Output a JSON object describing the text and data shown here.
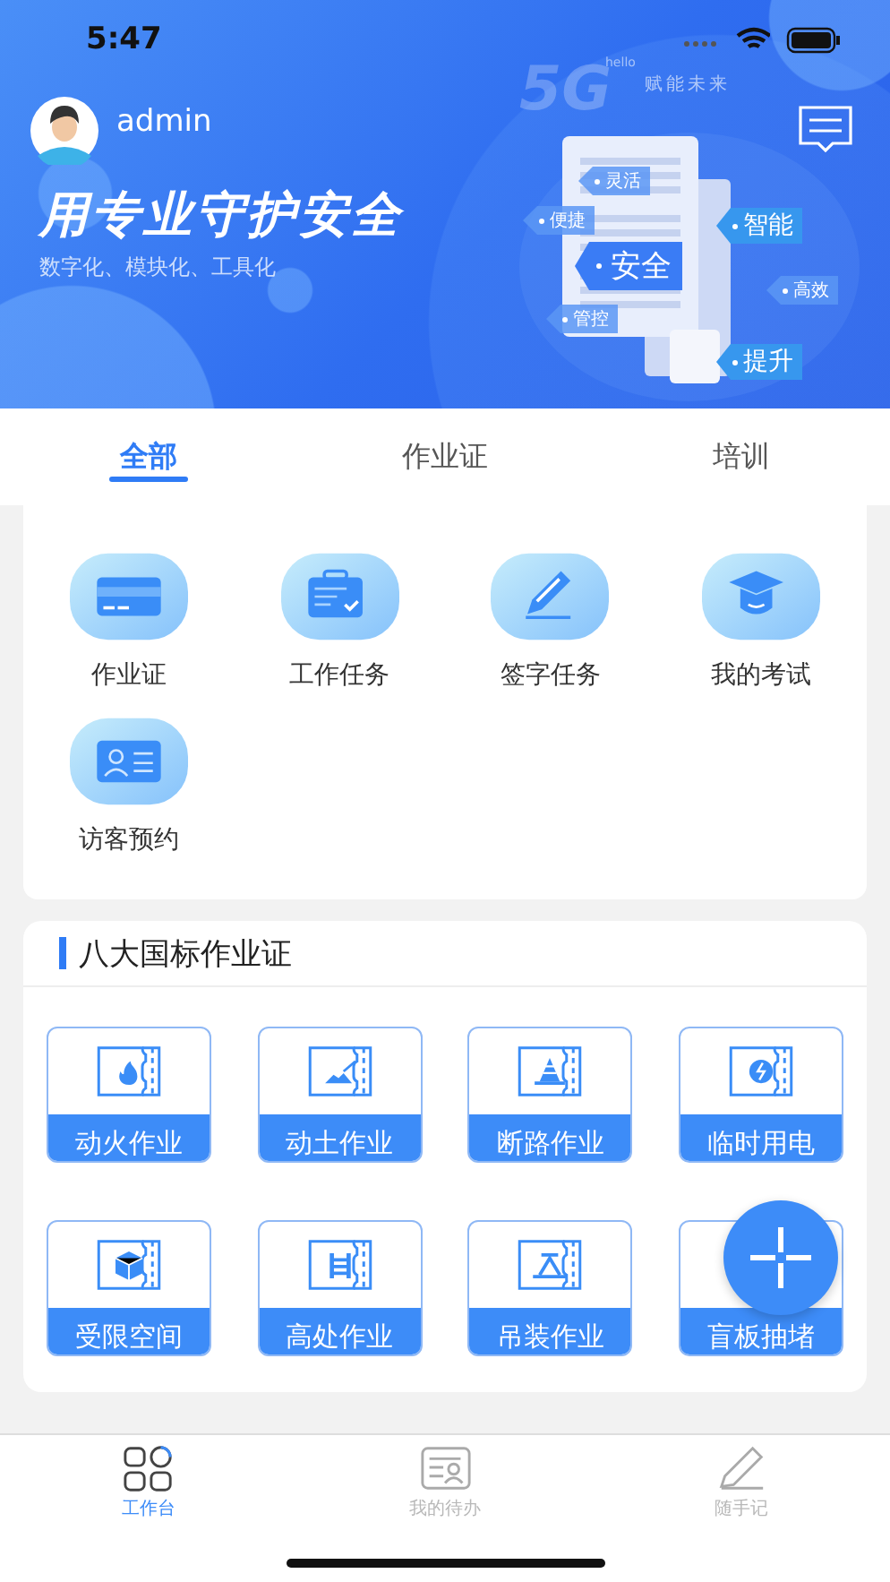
{
  "status_bar": {
    "time": "5:47"
  },
  "banner": {
    "user": "admin",
    "slogan": "用专业守护安全",
    "subtitle": "数字化、模块化、工具化",
    "badge": "5G",
    "badge_small": "hello",
    "motto": "赋能未来",
    "tags": [
      {
        "label": "灵活",
        "kind": "small"
      },
      {
        "label": "便捷",
        "kind": "small"
      },
      {
        "label": "智能",
        "kind": "medium"
      },
      {
        "label": "安全",
        "kind": "large"
      },
      {
        "label": "高效",
        "kind": "small"
      },
      {
        "label": "管控",
        "kind": "small"
      },
      {
        "label": "提升",
        "kind": "medium"
      }
    ]
  },
  "tabs": [
    {
      "label": "全部",
      "selected": true
    },
    {
      "label": "作业证",
      "selected": false
    },
    {
      "label": "培训",
      "selected": false
    }
  ],
  "quick_actions": [
    {
      "label": "作业证",
      "kind": "card"
    },
    {
      "label": "工作任务",
      "kind": "briefcase"
    },
    {
      "label": "签字任务",
      "kind": "pen"
    },
    {
      "label": "我的考试",
      "kind": "cap"
    },
    {
      "label": "访客预约",
      "kind": "id"
    }
  ],
  "permits": {
    "title": "八大国标作业证",
    "items": [
      {
        "label": "动火作业",
        "kind": "fire"
      },
      {
        "label": "动土作业",
        "kind": "soil"
      },
      {
        "label": "断路作业",
        "kind": "cone"
      },
      {
        "label": "临时用电",
        "kind": "power"
      },
      {
        "label": "受限空间",
        "kind": "cube"
      },
      {
        "label": "高处作业",
        "kind": "ladder"
      },
      {
        "label": "吊装作业",
        "kind": "crane"
      },
      {
        "label": "盲板抽堵",
        "kind": "hidden"
      }
    ]
  },
  "tab_bar": [
    {
      "label": "工作台",
      "kind": "grid",
      "selected": true
    },
    {
      "label": "我的待办",
      "kind": "todo",
      "selected": false
    },
    {
      "label": "随手记",
      "kind": "note",
      "selected": false
    }
  ]
}
